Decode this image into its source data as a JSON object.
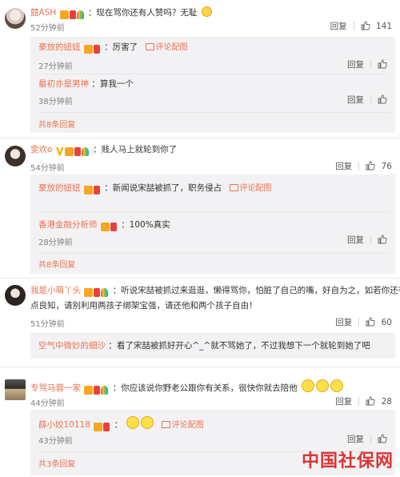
{
  "labels": {
    "reply": "回复",
    "comment_with_image": "评论配图"
  },
  "comments": [
    {
      "user": "囍ASH",
      "text": "：现在骂你还有人赞吗？无耻",
      "time": "52分钟前",
      "likes": "141",
      "replies": [
        {
          "user": "豪放的妞妞",
          "text": "：厉害了",
          "time": "27分钟前",
          "has_comment_image": true
        },
        {
          "user": "最初亦是男神",
          "text": "：算我一个",
          "time": "38分钟前",
          "has_comment_image": false
        }
      ],
      "more": "共8条回复"
    },
    {
      "user": "雯欢o",
      "text": "：贱人马上就轮到你了",
      "time": "54分钟前",
      "likes": "76",
      "replies": [
        {
          "user": "豪放的妞妞",
          "text": "：新闻说宋喆被抓了，职务侵占",
          "time": "",
          "has_comment_image": true
        },
        {
          "user": "香港金融分析师",
          "text": "：100%真实",
          "time": "28分钟前",
          "has_comment_image": false
        }
      ],
      "more": "共8条回复"
    },
    {
      "user": "我是小萌丫头",
      "text_line1": "：听说宋喆被抓过来逛逛，懒得骂你，怕脏了自己的嘴，好自为之，如若你还有",
      "text_line2": "点良知，请别利用两孩子绑架宝强，请还他和两个孩子自由！",
      "time": "51分钟前",
      "likes": "60",
      "replies": [
        {
          "user": "空气中微妙的细沙",
          "text": "：看了宋喆被抓好开心^_^就不骂她了，不过我想下一个就轮到她了吧",
          "time": "",
          "has_comment_image": false
        }
      ]
    },
    {
      "user": "专骂马蓉一家",
      "text": "：你应该说你野老公跟你有关系，很快你就去陪他",
      "time": "44分钟前",
      "likes": "28",
      "replies": [
        {
          "user": "薛小姣10118",
          "text": "：",
          "time": "43分钟前",
          "has_comment_image": true
        }
      ],
      "more": "共3条回复"
    }
  ],
  "watermark": "中国社保网",
  "icons": {
    "like": "thumbs-up-icon",
    "image": "image-icon",
    "emoji": "emoji-face-icon"
  }
}
